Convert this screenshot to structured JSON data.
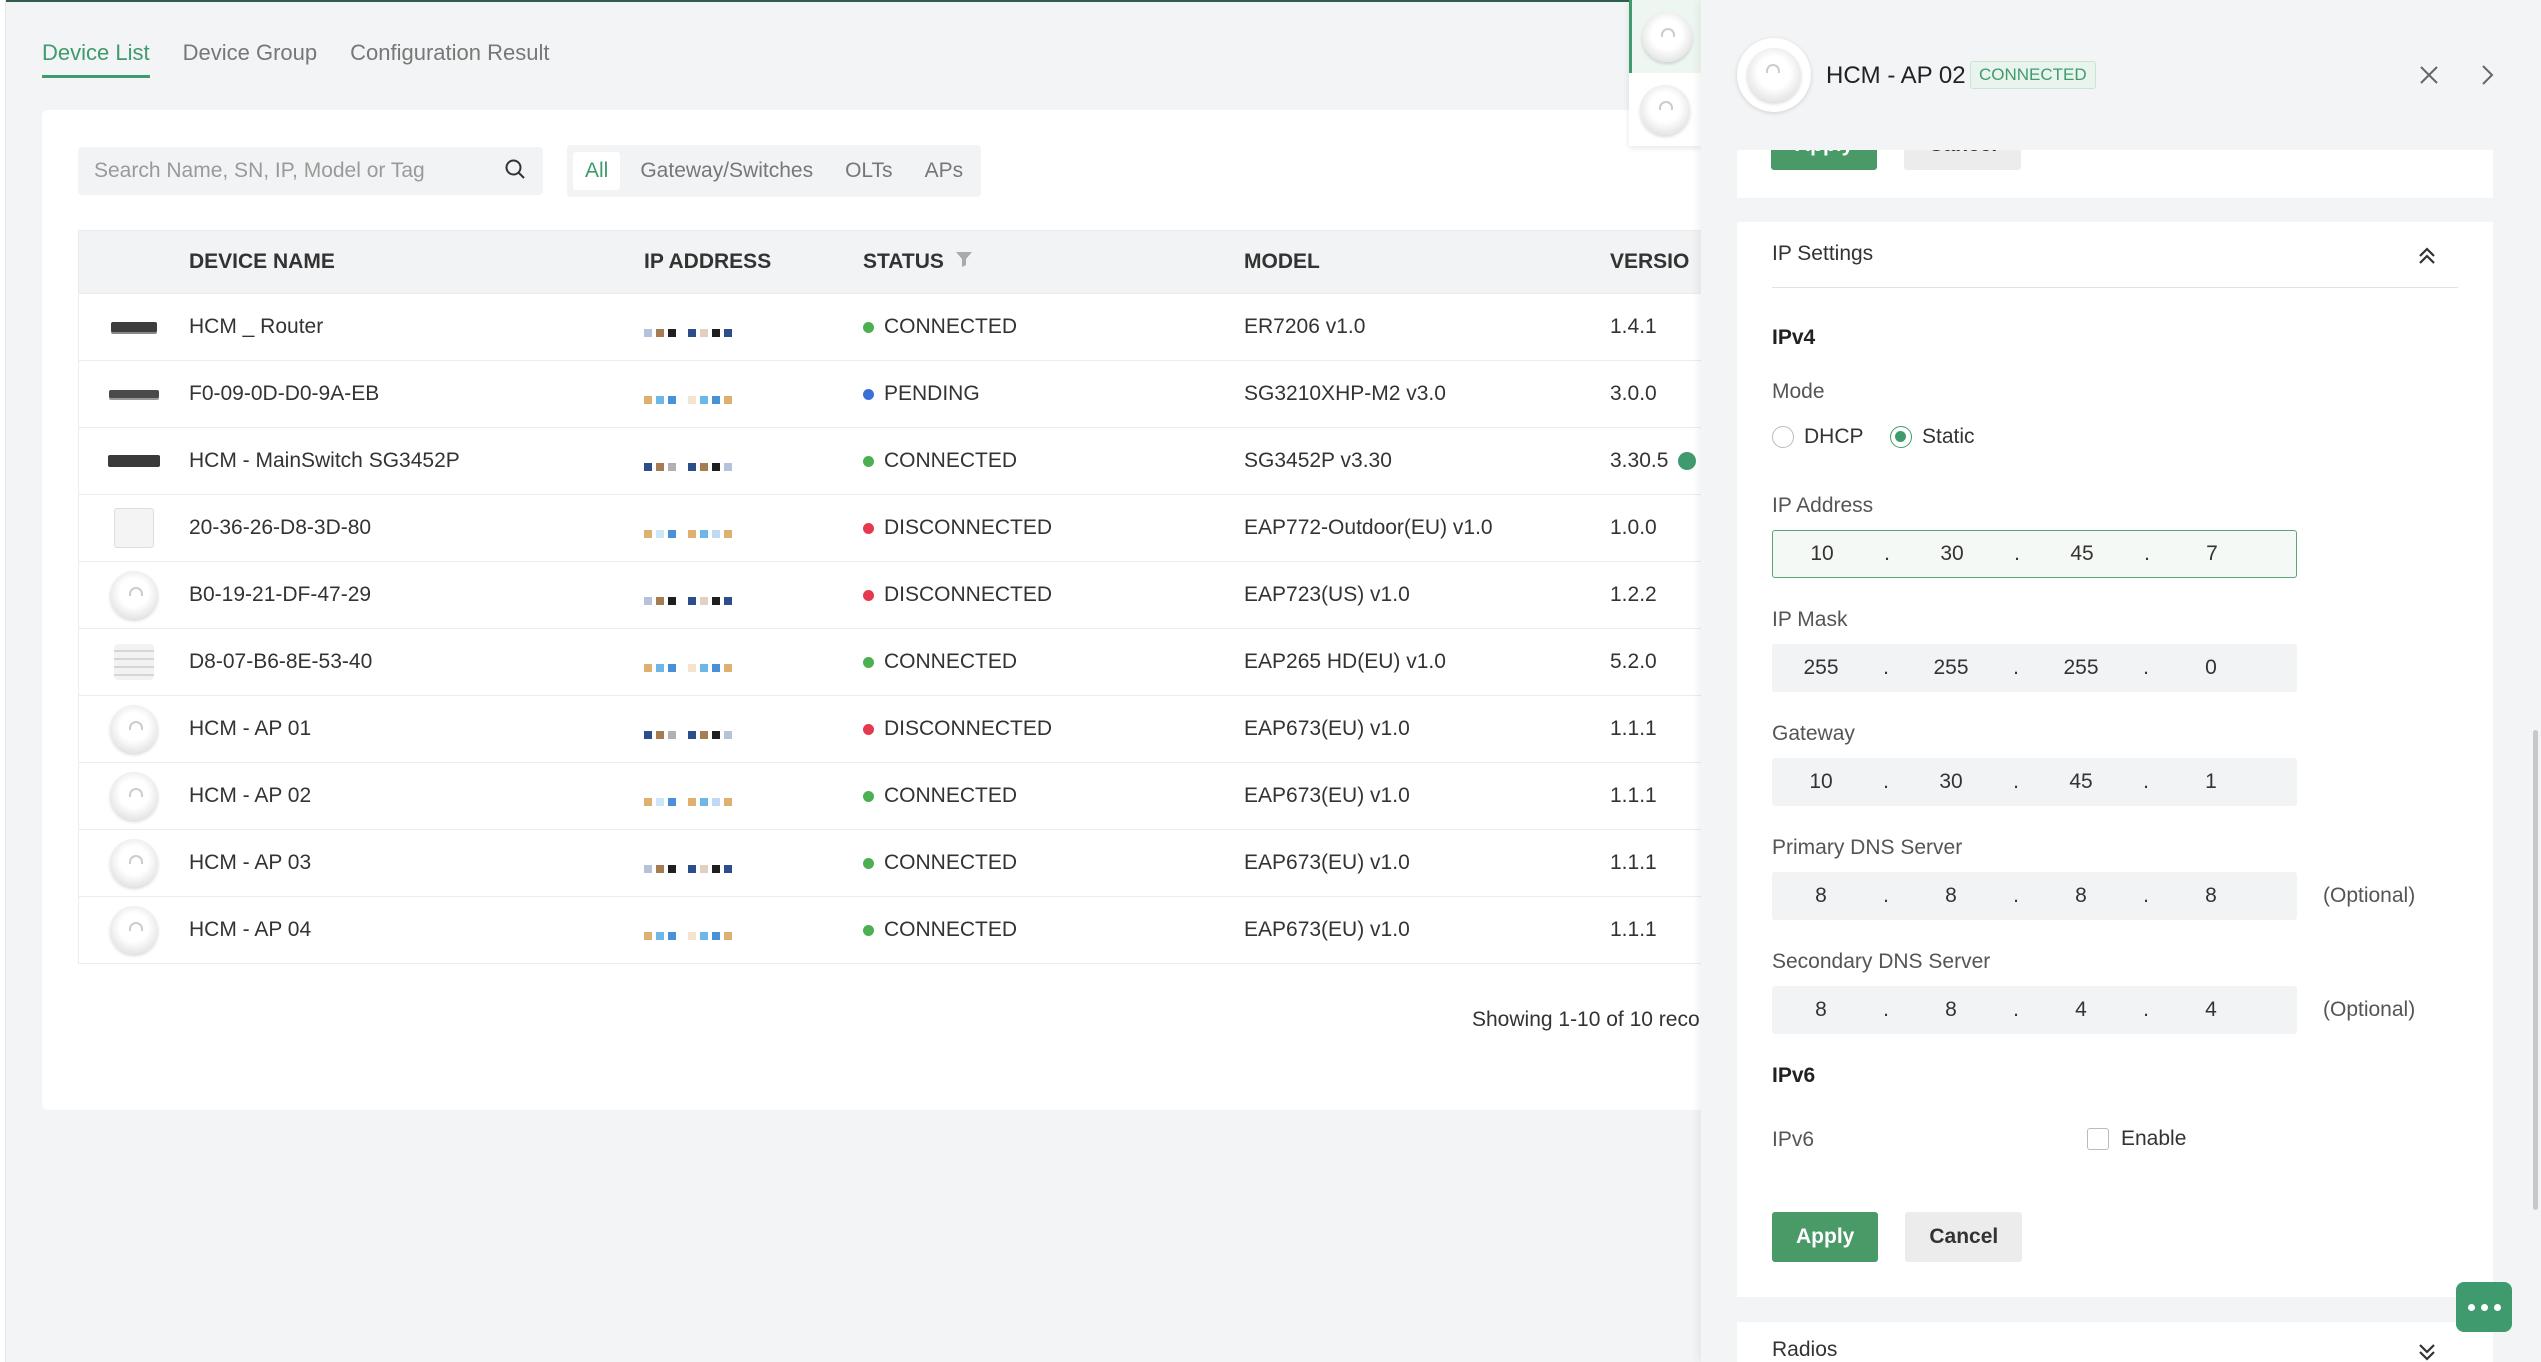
{
  "tabs": [
    {
      "label": "Device List",
      "active": true
    },
    {
      "label": "Device Group",
      "active": false
    },
    {
      "label": "Configuration Result",
      "active": false
    }
  ],
  "search": {
    "placeholder": "Search Name, SN, IP, Model or Tag"
  },
  "filters": [
    {
      "label": "All",
      "active": true
    },
    {
      "label": "Gateway/Switches",
      "active": false
    },
    {
      "label": "OLTs",
      "active": false
    },
    {
      "label": "APs",
      "active": false
    }
  ],
  "table": {
    "headers": {
      "name": "DEVICE NAME",
      "ip": "IP ADDRESS",
      "status": "STATUS",
      "model": "MODEL",
      "version": "VERSIO"
    },
    "rows": [
      {
        "icon": "router",
        "name": "HCM _ Router",
        "status": "CONNECTED",
        "status_color": "#4caf50",
        "model": "ER7206 v1.0",
        "version": "1.4.1"
      },
      {
        "icon": "switch",
        "name": "F0-09-0D-D0-9A-EB",
        "status": "PENDING",
        "status_color": "#3b6fd6",
        "model": "SG3210XHP-M2 v3.0",
        "version": "3.0.0"
      },
      {
        "icon": "switch2",
        "name": "HCM - MainSwitch SG3452P",
        "status": "CONNECTED",
        "status_color": "#4caf50",
        "model": "SG3452P v3.30",
        "version": "3.30.5"
      },
      {
        "icon": "outdoor",
        "name": "20-36-26-D8-3D-80",
        "status": "DISCONNECTED",
        "status_color": "#e53950",
        "model": "EAP772-Outdoor(EU) v1.0",
        "version": "1.0.0"
      },
      {
        "icon": "ap",
        "name": "B0-19-21-DF-47-29",
        "status": "DISCONNECTED",
        "status_color": "#e53950",
        "model": "EAP723(US) v1.0",
        "version": "1.2.2"
      },
      {
        "icon": "stack",
        "name": "D8-07-B6-8E-53-40",
        "status": "CONNECTED",
        "status_color": "#4caf50",
        "model": "EAP265 HD(EU) v1.0",
        "version": "5.2.0"
      },
      {
        "icon": "ap",
        "name": "HCM - AP 01",
        "status": "DISCONNECTED",
        "status_color": "#e53950",
        "model": "EAP673(EU) v1.0",
        "version": "1.1.1"
      },
      {
        "icon": "ap",
        "name": "HCM - AP 02",
        "status": "CONNECTED",
        "status_color": "#4caf50",
        "model": "EAP673(EU) v1.0",
        "version": "1.1.1"
      },
      {
        "icon": "ap",
        "name": "HCM - AP 03",
        "status": "CONNECTED",
        "status_color": "#4caf50",
        "model": "EAP673(EU) v1.0",
        "version": "1.1.1"
      },
      {
        "icon": "ap",
        "name": "HCM - AP 04",
        "status": "CONNECTED",
        "status_color": "#4caf50",
        "model": "EAP673(EU) v1.0",
        "version": "1.1.1"
      }
    ],
    "footer": "Showing 1-10 of 10 reco"
  },
  "drawer": {
    "title": "HCM - AP 02",
    "badge": "CONNECTED",
    "top_apply": "Apply",
    "top_cancel": "Cancel",
    "ip_settings": {
      "title": "IP Settings",
      "ipv4_heading": "IPv4",
      "mode_label": "Mode",
      "mode_dhcp": "DHCP",
      "mode_static": "Static",
      "selected_mode": "Static",
      "ip_label": "IP Address",
      "ip": [
        "10",
        "30",
        "45",
        "7"
      ],
      "mask_label": "IP Mask",
      "mask": [
        "255",
        "255",
        "255",
        "0"
      ],
      "gateway_label": "Gateway",
      "gateway": [
        "10",
        "30",
        "45",
        "1"
      ],
      "dns1_label": "Primary DNS Server",
      "dns1": [
        "8",
        "8",
        "8",
        "8"
      ],
      "dns2_label": "Secondary DNS Server",
      "dns2": [
        "8",
        "8",
        "4",
        "4"
      ],
      "optional": "(Optional)",
      "ipv6_heading": "IPv6",
      "ipv6_label": "IPv6",
      "ipv6_enable": "Enable",
      "apply": "Apply",
      "cancel": "Cancel"
    },
    "radios_title": "Radios"
  },
  "colors": {
    "accent": "#3f9b6d",
    "connected": "#4caf50",
    "pending": "#3b6fd6",
    "disconnected": "#e53950"
  }
}
